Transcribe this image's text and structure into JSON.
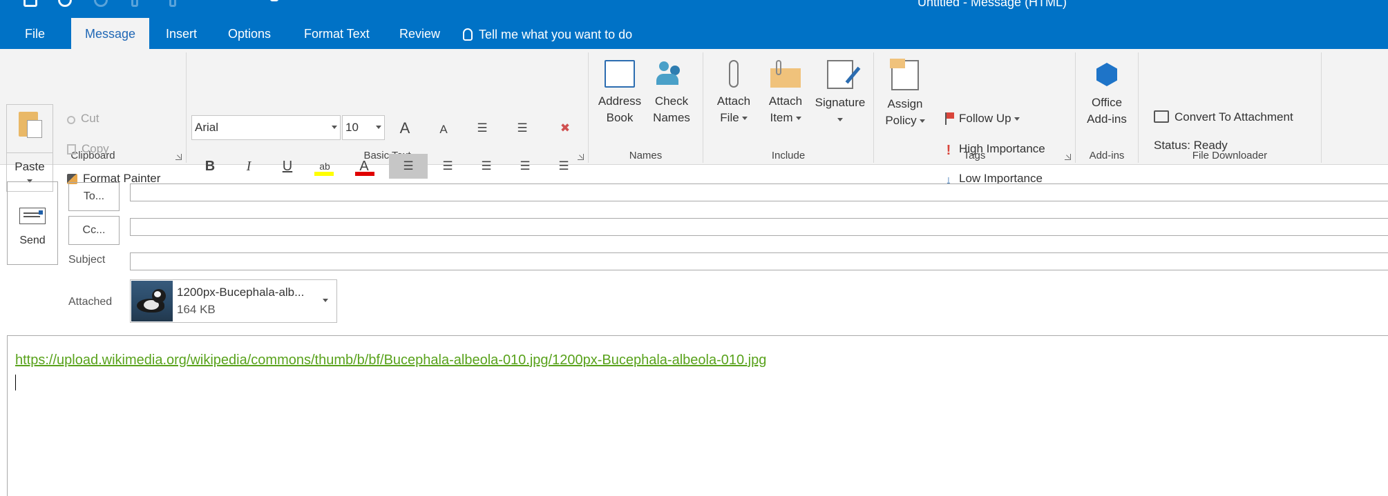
{
  "window": {
    "title": "Untitled  -  Message (HTML)"
  },
  "quick_access": {
    "icons": [
      "save-icon",
      "undo-icon",
      "redo-icon",
      "up-icon",
      "down-icon",
      "customize-icon"
    ]
  },
  "tabs": [
    {
      "label": "File",
      "active": false
    },
    {
      "label": "Message",
      "active": true
    },
    {
      "label": "Insert",
      "active": false
    },
    {
      "label": "Options",
      "active": false
    },
    {
      "label": "Format Text",
      "active": false
    },
    {
      "label": "Review",
      "active": false
    }
  ],
  "tell_me": "Tell me what you want to do",
  "ribbon": {
    "clipboard": {
      "label": "Clipboard",
      "paste": "Paste",
      "cut": "Cut",
      "copy": "Copy",
      "format_painter": "Format Painter"
    },
    "basic_text": {
      "label": "Basic Text",
      "font": "Arial",
      "size": "10",
      "bold": "B",
      "italic": "I",
      "underline": "U"
    },
    "names": {
      "label": "Names",
      "address_book": [
        "Address",
        "Book"
      ],
      "check_names": [
        "Check",
        "Names"
      ]
    },
    "include": {
      "label": "Include",
      "attach_file": [
        "Attach",
        "File"
      ],
      "attach_item": [
        "Attach",
        "Item"
      ],
      "signature": "Signature"
    },
    "tags": {
      "label": "Tags",
      "assign_policy": [
        "Assign",
        "Policy"
      ],
      "follow_up": "Follow Up",
      "high_importance": "High Importance",
      "low_importance": "Low Importance"
    },
    "addins": {
      "label": "Add-ins",
      "office_addins": [
        "Office",
        "Add-ins"
      ]
    },
    "file_downloader": {
      "label": "File Downloader",
      "convert": "Convert To Attachment",
      "status": "Status: Ready"
    }
  },
  "compose": {
    "send": "Send",
    "to": "To...",
    "cc": "Cc...",
    "subject_label": "Subject",
    "attached_label": "Attached",
    "attachment": {
      "name": "1200px-Bucephala-alb...",
      "size": "164 KB"
    },
    "body_link": "https://upload.wikimedia.org/wikipedia/commons/thumb/b/bf/Bucephala-albeola-010.jpg/1200px-Bucephala-albeola-010.jpg"
  },
  "colors": {
    "title_bar": "#0072c6",
    "ribbon_bg": "#f3f3f3",
    "link": "#58a21b",
    "highlight": "#ffff00",
    "font_color": "#e00000"
  }
}
